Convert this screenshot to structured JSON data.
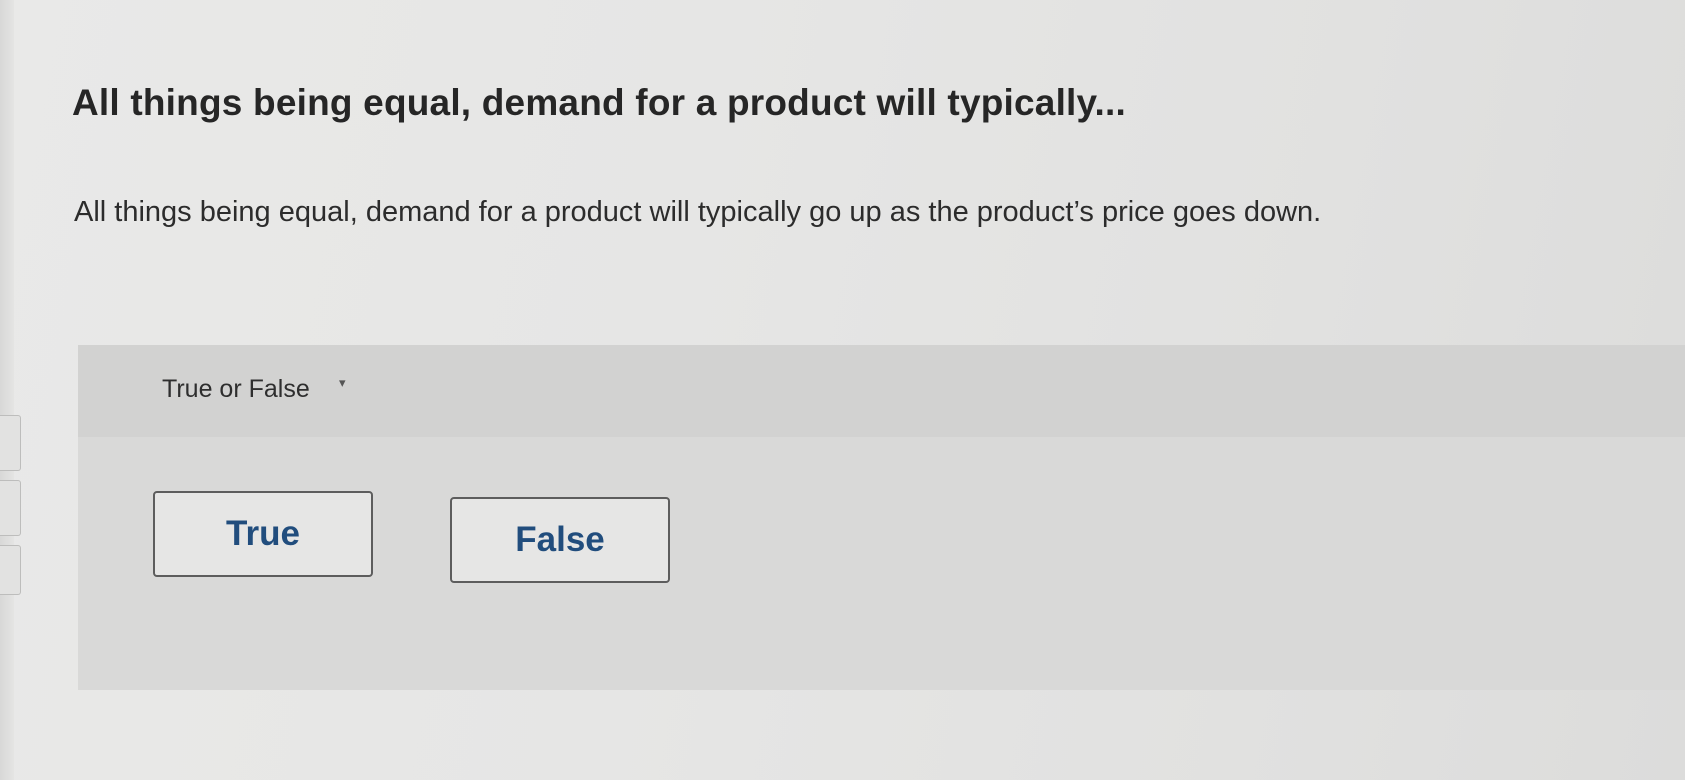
{
  "question": {
    "title": "All things being equal, demand for a product will typically...",
    "body": "All things being equal, demand for a product will typically go up as the product’s price goes down."
  },
  "answer": {
    "type_label": "True or False",
    "type_caret": "▾",
    "choices": [
      {
        "label": "True"
      },
      {
        "label": "False"
      }
    ]
  },
  "colors": {
    "page_background": "#e6e6e5",
    "panel_background": "#d9d9d8",
    "header_background": "#d2d2d1",
    "choice_text": "#214d7d",
    "choice_border": "#5d5d5d"
  }
}
